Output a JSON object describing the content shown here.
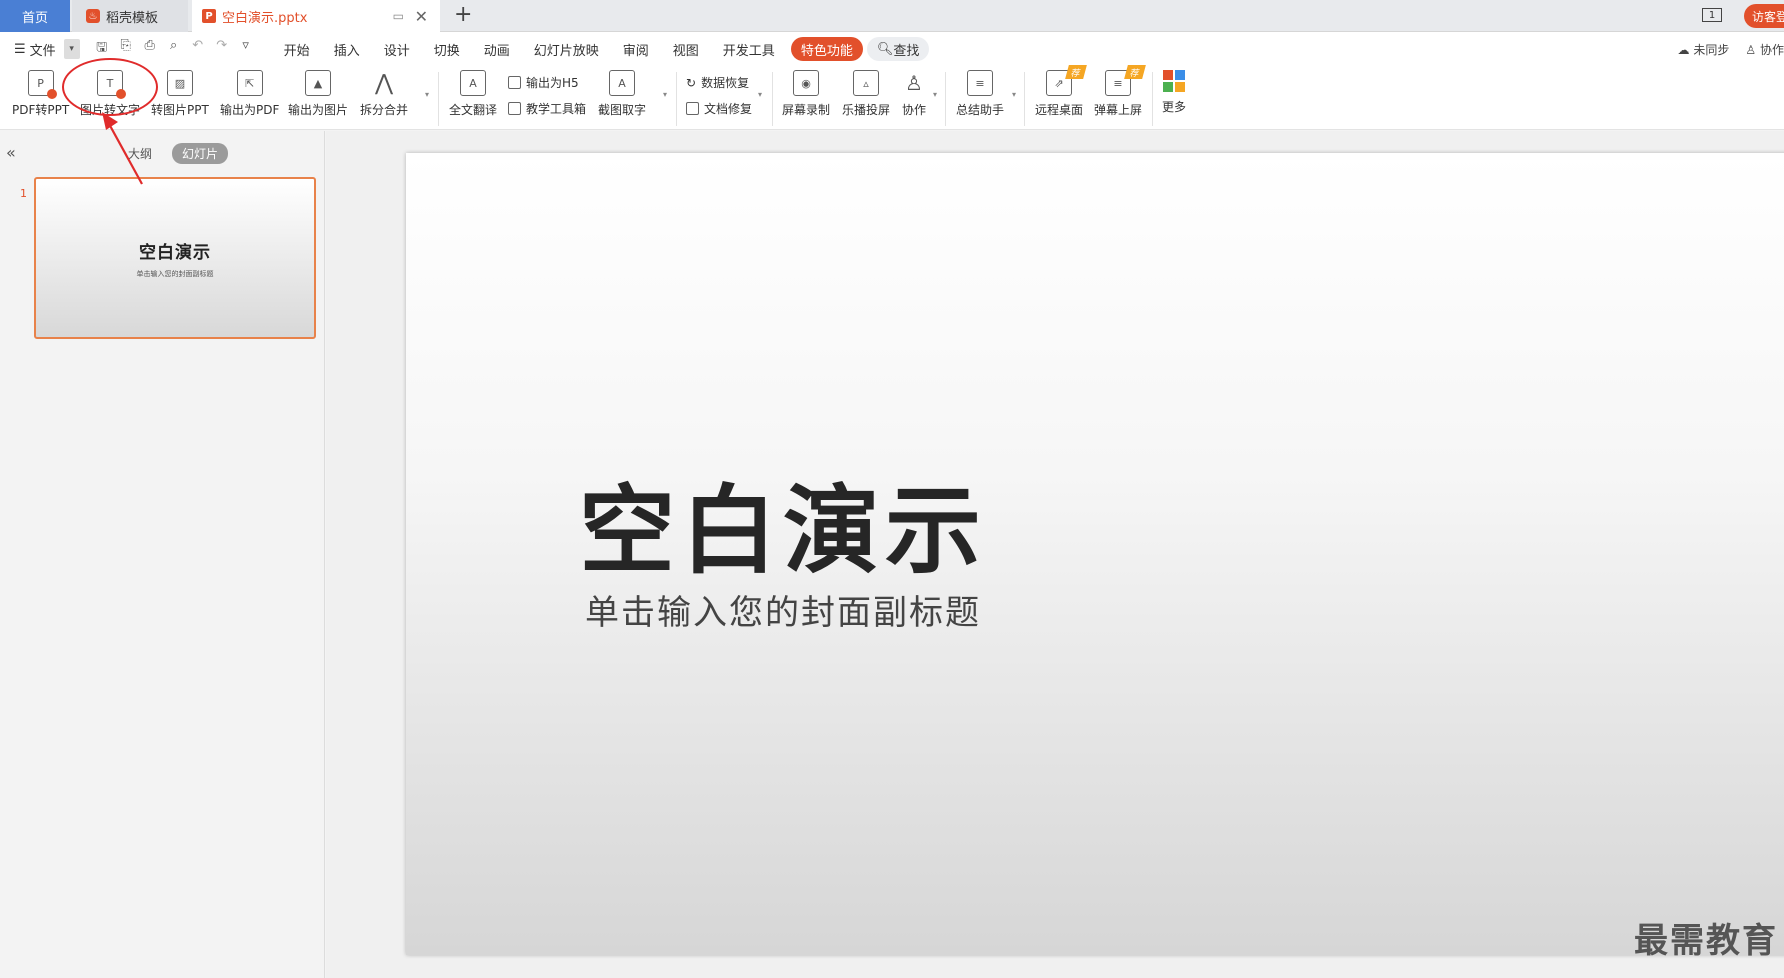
{
  "tabs": {
    "home": "首页",
    "template": "稻壳模板",
    "document": "空白演示.pptx",
    "page_badge": "1",
    "visitor": "访客登录"
  },
  "menu": {
    "file": "文件",
    "items": [
      "开始",
      "插入",
      "设计",
      "切换",
      "动画",
      "幻灯片放映",
      "审阅",
      "视图",
      "开发工具"
    ],
    "special": "特色功能",
    "search": "查找",
    "unsync": "未同步",
    "collab": "协作"
  },
  "ribbon": {
    "pdf_to_ppt": "PDF转PPT",
    "img_to_text": "图片转文字",
    "img_to_ppt": "转图片PPT",
    "export_pdf": "输出为PDF",
    "export_img": "输出为图片",
    "split_merge": "拆分合并",
    "translate": "全文翻译",
    "export_h5": "输出为H5",
    "teach_tools": "教学工具箱",
    "screenshot_text": "截图取字",
    "data_recovery": "数据恢复",
    "doc_repair": "文档修复",
    "screen_record": "屏幕录制",
    "cast": "乐播投屏",
    "cooperate": "协作",
    "summary": "总结助手",
    "remote_desktop": "远程桌面",
    "barrage": "弹幕上屏",
    "more": "更多"
  },
  "panel": {
    "outline": "大纲",
    "slides": "幻灯片",
    "slide_number": "1",
    "thumb_title": "空白演示",
    "thumb_subtitle": "单击输入您的封面副标题"
  },
  "slide": {
    "title": "空白演示",
    "subtitle": "单击输入您的封面副标题"
  },
  "watermark": "最需教育",
  "colors": {
    "accent": "#e2502b",
    "home_tab": "#4a7fd4",
    "annotation": "#e02b2b"
  }
}
